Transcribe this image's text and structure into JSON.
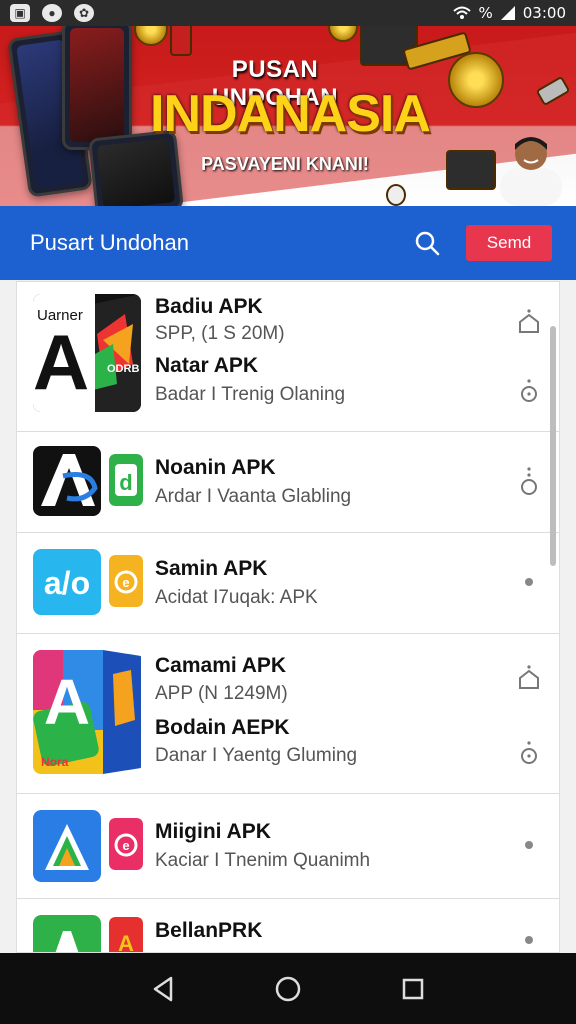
{
  "status_bar": {
    "time": "03:00",
    "battery_text": "%"
  },
  "banner": {
    "line1": "PUSAN UNDOHAN",
    "line2": "INDANASIA",
    "line3": "PASVAYENI KNANI!"
  },
  "app_bar": {
    "title": "Pusart Undohan",
    "send_label": "Semd",
    "search_icon": "search-icon"
  },
  "items": [
    {
      "name": "Badiu APK",
      "sub": "SPP, (1 S 20M)",
      "name2": "Natar APK",
      "sub2": "Badar I Trenig Olaning",
      "icon_letter": "A",
      "icon_top_text": "Uarner",
      "badge_text": "ODRB",
      "action": "home-icon",
      "action2": "info-dot-icon"
    },
    {
      "name": "Noanin APK",
      "sub": "Ardar I Vaanta Glabling",
      "icon_letter": "A",
      "small_letter": "d",
      "action": "info-dot-icon"
    },
    {
      "name": "Samin APK",
      "sub": "Acidat I7uqak: APK",
      "icon_letter": "a/o",
      "small_letter": "e",
      "action": "dot-icon"
    },
    {
      "name": "Camami APK",
      "sub": "APP (N 1249M)",
      "name2": "Bodain AEPK",
      "sub2": "Danar I Yaentg Gluming",
      "icon_letter": "A",
      "icon_bottom_text": "Nora",
      "action": "home-icon",
      "action2": "info-dot-icon"
    },
    {
      "name": "Miigini APK",
      "sub": "Kaciar I Tnenim Quanimh",
      "icon_letter": "A",
      "small_letter": "e",
      "action": "dot-icon"
    },
    {
      "name": "BellanPRK",
      "sub": "",
      "icon_letter": "A",
      "small_letter": "A",
      "action": "dot-icon"
    }
  ],
  "nav": {
    "back": "back-icon",
    "home": "home-circle-icon",
    "recents": "recents-icon"
  },
  "colors": {
    "app_bar": "#1d61d0",
    "send_button": "#e8364f",
    "banner_red": "#c81a1a",
    "banner_yellow": "#ffd21a"
  }
}
